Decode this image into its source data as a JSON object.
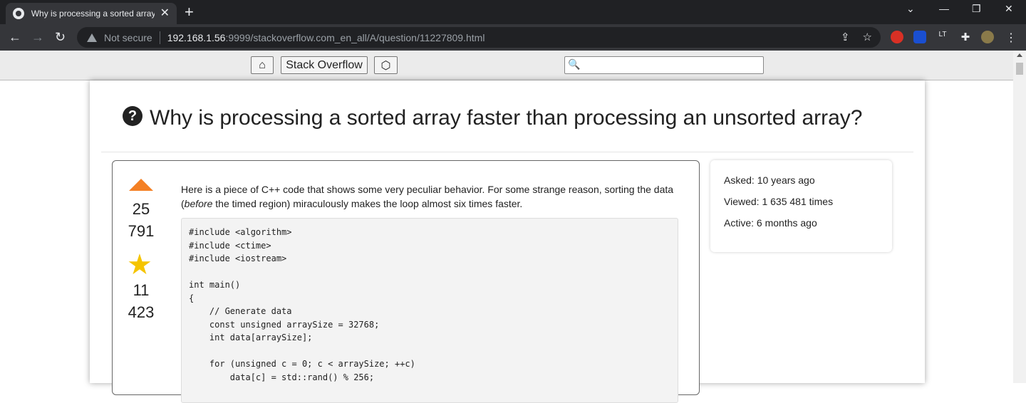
{
  "browser": {
    "tab_title": "Why is processing a sorted array faster than processing an unsorted array?",
    "tab_close": "✕",
    "new_tab": "+",
    "not_secure": "Not secure",
    "url_host": "192.168.1.56",
    "url_rest": ":9999/stackoverflow.com_en_all/A/question/11227809.html"
  },
  "toolbar": {
    "home_icon": "⌂",
    "site_name": "Stack Overflow",
    "random_icon": "⬡",
    "search_placeholder": ""
  },
  "question": {
    "title": "Why is processing a sorted array faster than processing an unsorted array?",
    "icon": "?",
    "votes_line1": "25",
    "votes_line2": "791",
    "favorites_line1": "11",
    "favorites_line2": "423",
    "body_part1": "Here is a piece of C++ code that shows some very peculiar behavior. For some strange reason, sorting the data (",
    "body_em": "before",
    "body_part2": " the timed region) miraculously makes the loop almost six times faster.",
    "code": "#include <algorithm>\n#include <ctime>\n#include <iostream>\n\nint main()\n{\n    // Generate data\n    const unsigned arraySize = 32768;\n    int data[arraySize];\n\n    for (unsigned c = 0; c < arraySize; ++c)\n        data[c] = std::rand() % 256;"
  },
  "stats": {
    "asked": "Asked: 10 years ago",
    "viewed": "Viewed: 1 635 481 times",
    "active": "Active: 6 months ago"
  },
  "colors": {
    "upvote": "#f48024",
    "star": "#f5c400"
  }
}
